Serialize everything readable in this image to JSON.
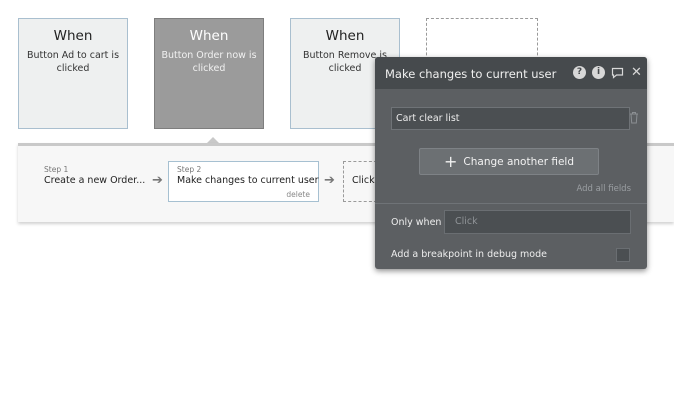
{
  "events": [
    {
      "when": "When",
      "description": "Button Ad to cart is clicked"
    },
    {
      "when": "When",
      "description": "Button Order now is clicked"
    },
    {
      "when": "When",
      "description": "Button Remove is clicked"
    }
  ],
  "workflow": {
    "step1": {
      "num": "Step 1",
      "title": "Create a new Order..."
    },
    "step2": {
      "num": "Step 2",
      "title": "Make changes to current user",
      "delete": "delete"
    },
    "add_step_label": "Click"
  },
  "panel": {
    "title": "Make changes to current user",
    "icons": [
      "help-icon",
      "info-icon",
      "comment-icon",
      "close-icon"
    ],
    "field_value": "Cart clear list",
    "change_button": "Change another field",
    "add_all": "Add all fields",
    "only_when_label": "Only when",
    "only_when_placeholder": "Click",
    "breakpoint_label": "Add a breakpoint in debug mode"
  }
}
